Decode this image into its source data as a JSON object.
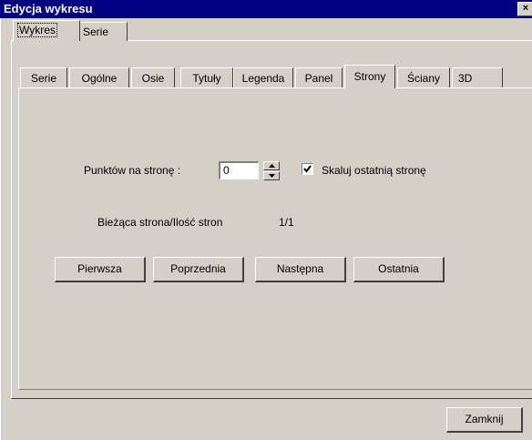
{
  "window": {
    "title": "Edycja wykresu",
    "close_label": "×"
  },
  "outer_tabs": [
    {
      "label": "Wykres",
      "active": true
    },
    {
      "label": "Serie",
      "active": false
    }
  ],
  "inner_tabs": [
    {
      "label": "Serie"
    },
    {
      "label": "Ogólne"
    },
    {
      "label": "Osie"
    },
    {
      "label": "Tytuły"
    },
    {
      "label": "Legenda"
    },
    {
      "label": "Panel"
    },
    {
      "label": "Strony",
      "active": true
    },
    {
      "label": "Ściany"
    },
    {
      "label": "3D"
    }
  ],
  "strony": {
    "points_label": "Punktów na stronę  :",
    "points_value": "0",
    "scale_last_label": "Skaluj ostatnią stronę",
    "scale_last_checked": true,
    "current_label": "Bieżąca strona/Ilość stron",
    "current_value": "1/1",
    "buttons": {
      "first": "Pierwsza",
      "prev": "Poprzednia",
      "next": "Następna",
      "last": "Ostatnia"
    }
  },
  "footer": {
    "close_label": "Zamknij"
  }
}
